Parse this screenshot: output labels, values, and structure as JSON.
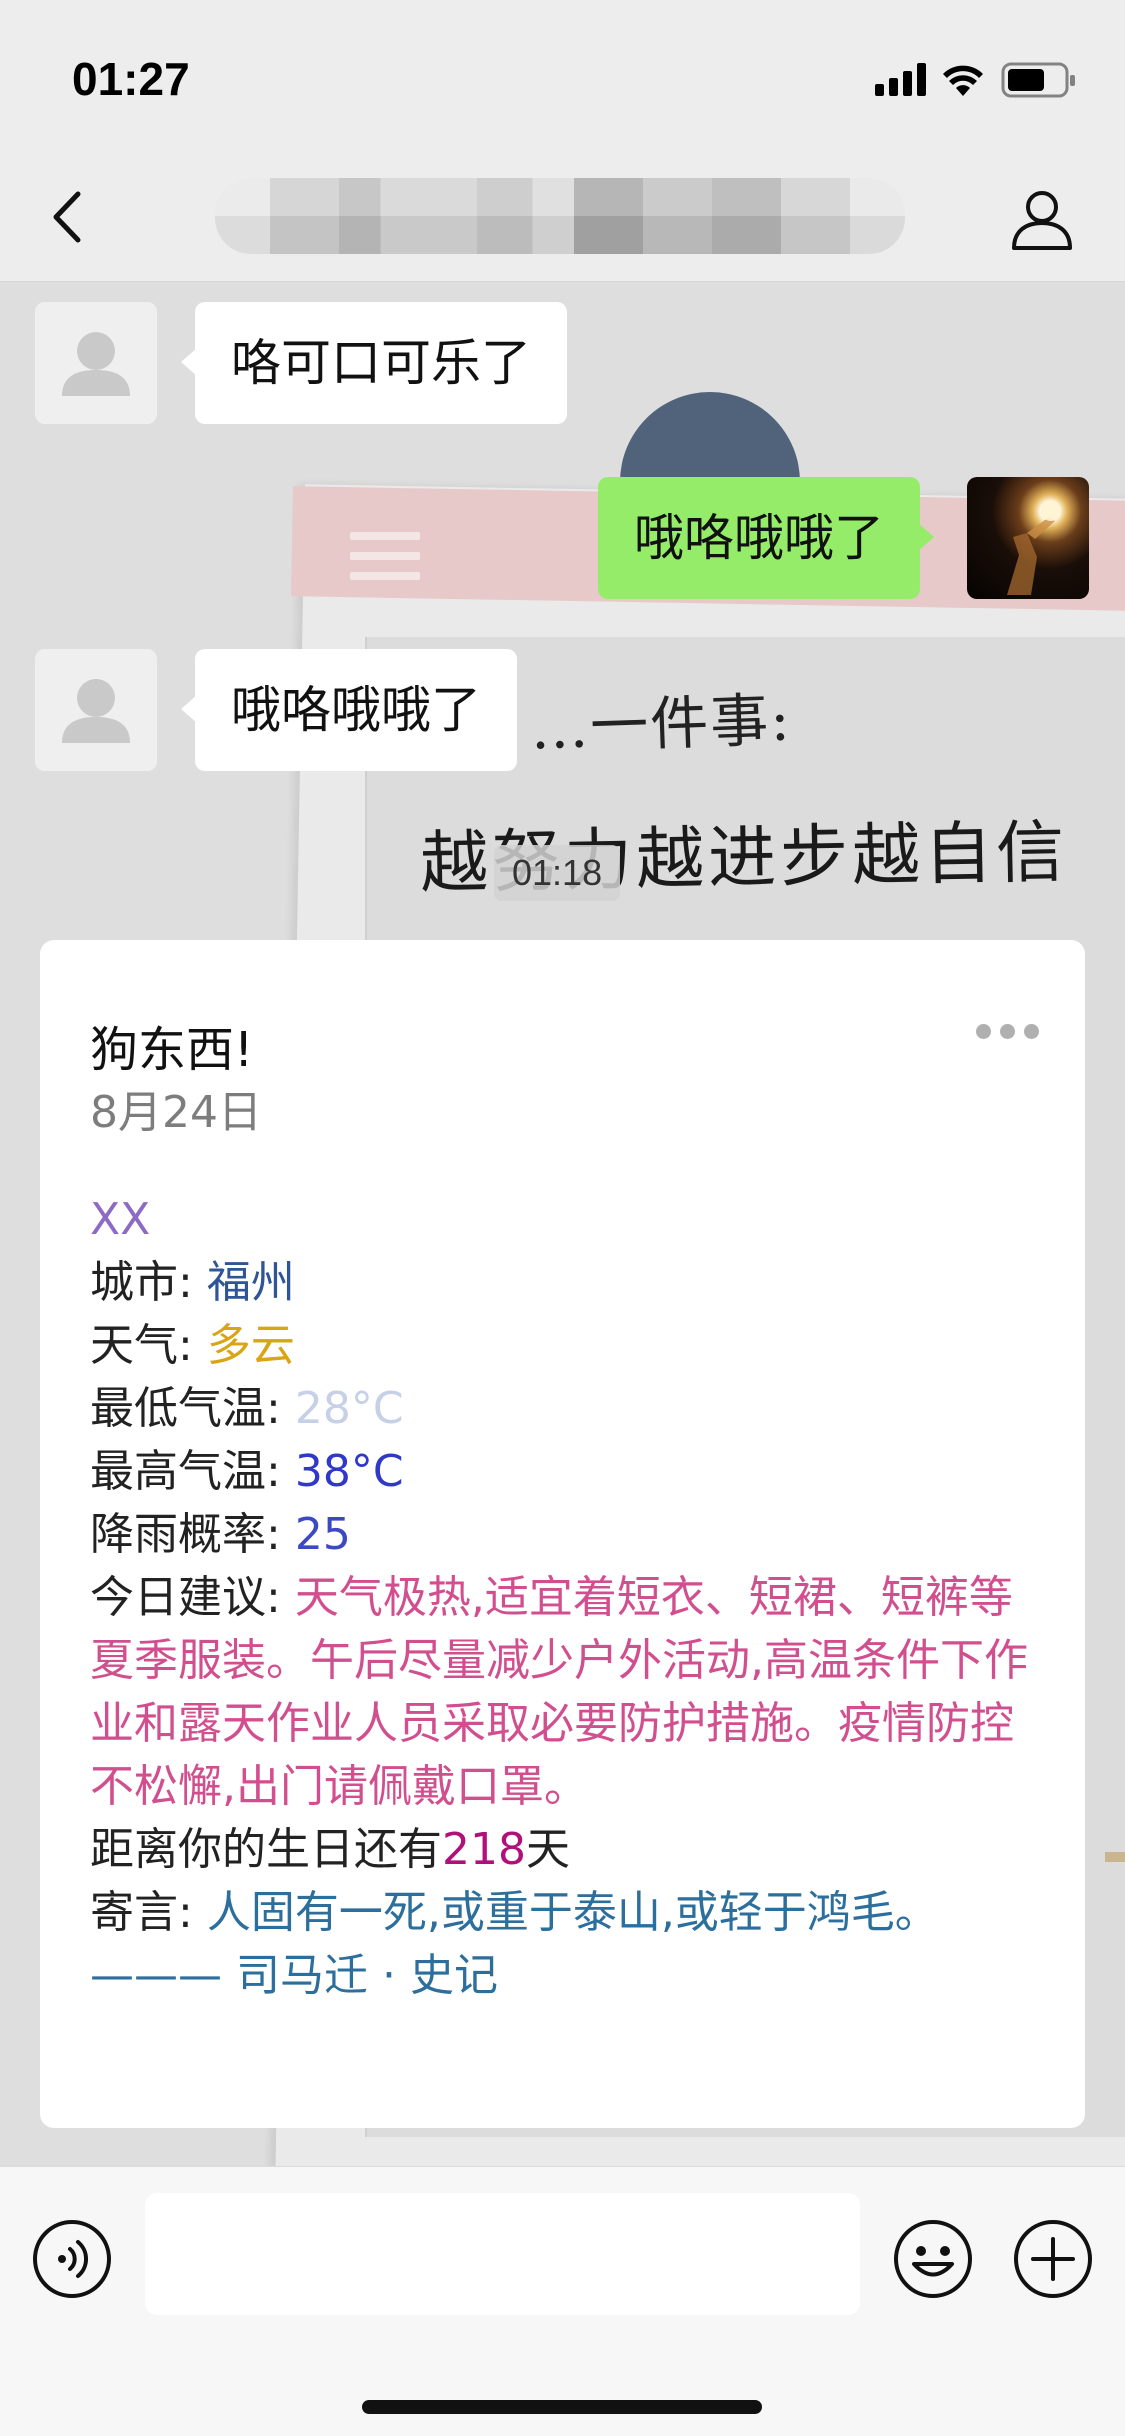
{
  "status_bar": {
    "time": "01:27",
    "signal_icon": "cellular-signal-icon",
    "wifi_icon": "wifi-icon",
    "battery_icon": "battery-icon"
  },
  "nav": {
    "title": "",
    "back_icon": "chevron-left-icon",
    "profile_icon": "person-icon"
  },
  "wallpaper": {
    "line1": "…一件事:",
    "line2": "越努力越进步越自信"
  },
  "timestamp": "01:18",
  "messages": [
    {
      "side": "left",
      "text": "咯可口可乐了",
      "avatar": "default-avatar-icon"
    },
    {
      "side": "right",
      "text": "哦咯哦哦了",
      "avatar": "user-photo"
    },
    {
      "side": "left",
      "text": "哦咯哦哦了",
      "avatar": "default-avatar-icon"
    }
  ],
  "card": {
    "title": "狗东西!",
    "date": "8月24日",
    "more_icon": "more-dots-icon",
    "name": "XX",
    "city_label": "城市:",
    "city_value": "福州",
    "weather_label": "天气:",
    "weather_value": "多云",
    "low_label": "最低气温:",
    "low_value": "28°C",
    "high_label": "最高气温:",
    "high_value": "38°C",
    "rain_label": "降雨概率:",
    "rain_value": "25",
    "advice_label": "今日建议:",
    "advice_value": "天气极热,适宜着短衣、短裙、短裤等夏季服装。午后尽量减少户外活动,高温条件下作业和露天作业人员采取必要防护措施。疫情防控不松懈,出门请佩戴口罩。",
    "birthday_prefix": "距离你的生日还有",
    "birthday_days": "218",
    "birthday_suffix": "天",
    "motto_label": "寄言:",
    "motto_value": "人固有一死,或重于泰山,或轻于鸿毛。 ——— 司马迁 · 史记"
  },
  "input_bar": {
    "voice_icon": "voice-icon",
    "text_value": "",
    "emoji_icon": "emoji-icon",
    "plus_icon": "plus-icon"
  },
  "colors": {
    "bubble_right": "#95ec69",
    "name": "#8d6ac4",
    "city": "#2f5597",
    "weather": "#d9a516",
    "low_temp": "#c6d0e6",
    "high_temp": "#2f38c9",
    "advice": "#d24f8f",
    "birthday": "#b0107a",
    "motto": "#2c6e9c"
  }
}
